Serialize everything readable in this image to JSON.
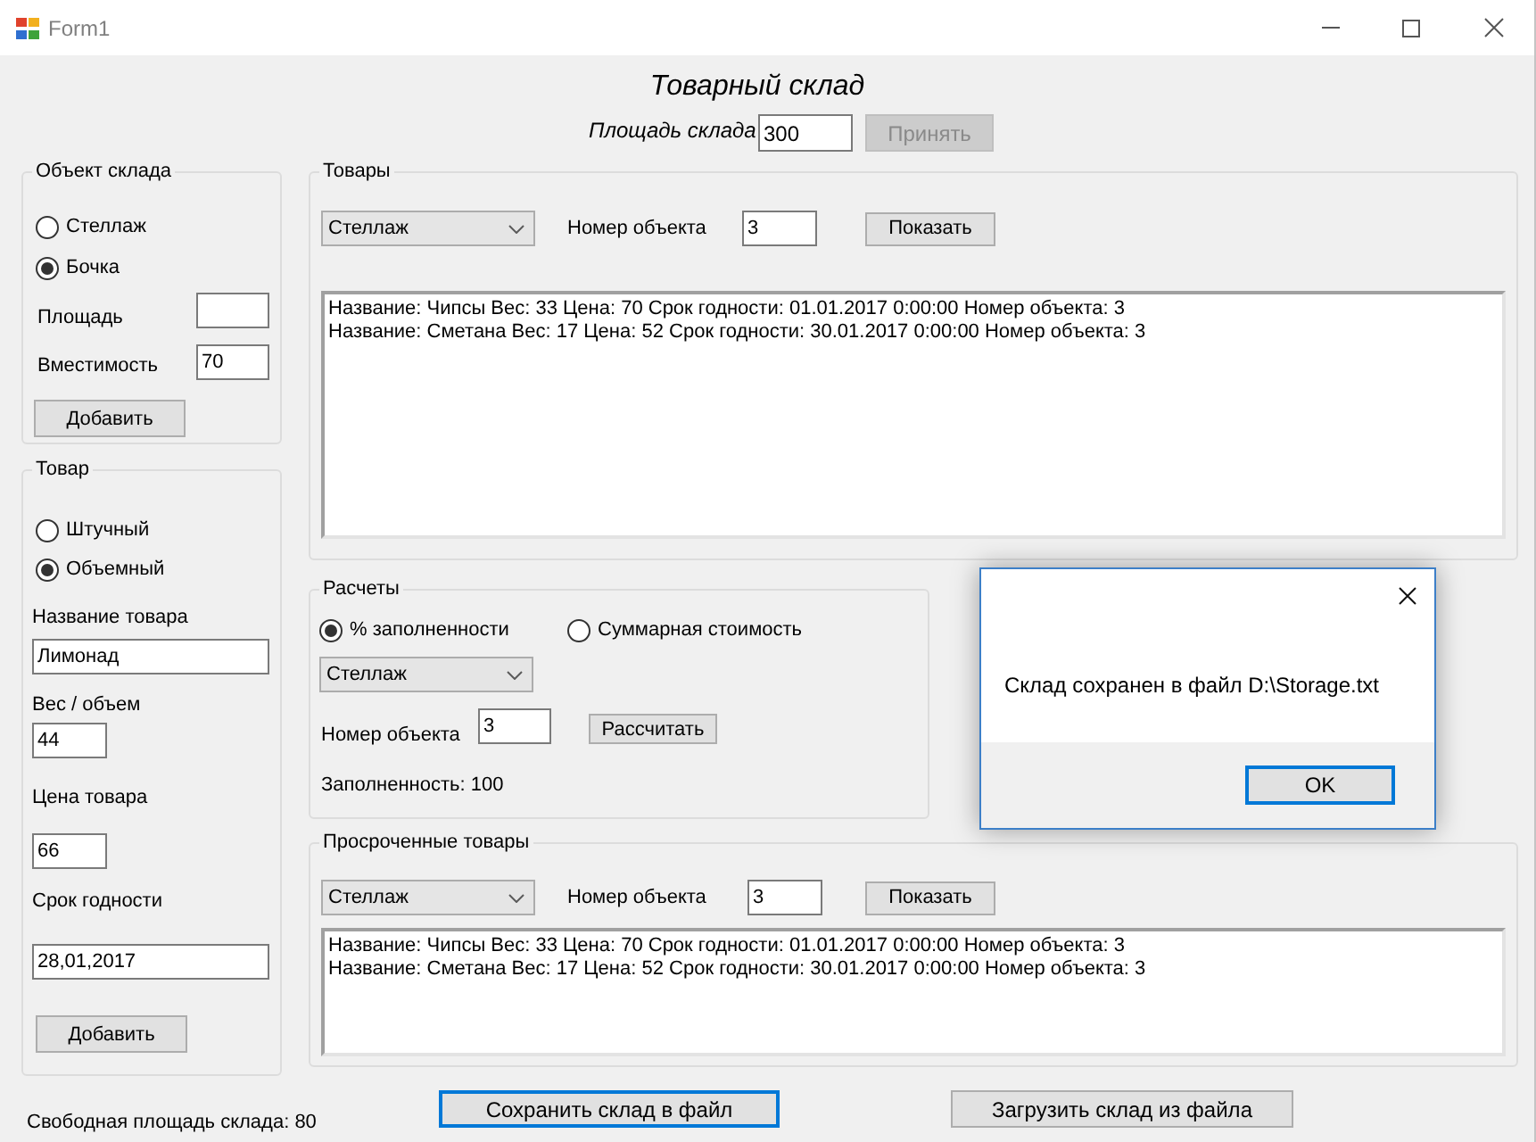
{
  "window": {
    "title": "Form1"
  },
  "header": {
    "title": "Товарный склад",
    "area_label": "Площадь склада",
    "area_value": "300",
    "accept_button": {
      "label": "Принять",
      "disabled": true
    }
  },
  "storage_object": {
    "title": "Объект склада",
    "types": [
      {
        "label": "Стеллаж",
        "selected": false
      },
      {
        "label": "Бочка",
        "selected": true
      }
    ],
    "area": {
      "label": "Площадь"
    },
    "capacity": {
      "label": "Вместимость",
      "value": "70"
    },
    "add_button": "Добавить"
  },
  "product": {
    "title": "Товар",
    "types": [
      {
        "label": "Штучный",
        "selected": false
      },
      {
        "label": "Объемный",
        "selected": true
      }
    ],
    "name": {
      "label": "Название товара",
      "value": "Лимонад"
    },
    "weight": {
      "label": "Вес / объем",
      "value": "44"
    },
    "price": {
      "label": "Цена товара",
      "value": "66"
    },
    "expiry": {
      "label": "Срок годности",
      "value": "28,01,2017"
    },
    "add_button": "Добавить"
  },
  "goods": {
    "title": "Товары",
    "object_type": "Стеллаж",
    "object_number_label": "Номер объекта",
    "object_number": "3",
    "show_button": "Показать",
    "items": [
      "Название: Чипсы Вес: 33 Цена: 70 Срок годности: 01.01.2017 0:00:00 Номер объекта: 3",
      "Название: Сметана Вес: 17 Цена: 52 Срок годности: 30.01.2017 0:00:00 Номер объекта: 3"
    ]
  },
  "calculations": {
    "title": "Расчеты",
    "modes": [
      {
        "label": "% заполненности",
        "selected": true
      },
      {
        "label": "Суммарная стоимость",
        "selected": false
      }
    ],
    "object_type": "Стеллаж",
    "object_number_label": "Номер объекта",
    "object_number": "3",
    "calculate_button": "Рассчитать",
    "result": "Заполненность: 100"
  },
  "expired_goods": {
    "title": "Просроченные товары",
    "object_type": "Стеллаж",
    "object_number_label": "Номер объекта",
    "object_number": "3",
    "show_button": "Показать",
    "items": [
      "Название: Чипсы Вес: 33 Цена: 70 Срок годности: 01.01.2017 0:00:00 Номер объекта: 3",
      "Название: Сметана Вес: 17 Цена: 52 Срок годности: 30.01.2017 0:00:00 Номер объекта: 3"
    ]
  },
  "free_area": "Свободная площадь склада: 80",
  "save_button": {
    "label": "Сохранить склад в файл",
    "focused": true
  },
  "load_button": {
    "label": "Загрузить склад из файла",
    "focused": false
  },
  "dialog": {
    "message": "Склад сохранен в файл D:\\Storage.txt",
    "ok_button": {
      "label": "OK",
      "focused": true
    }
  }
}
